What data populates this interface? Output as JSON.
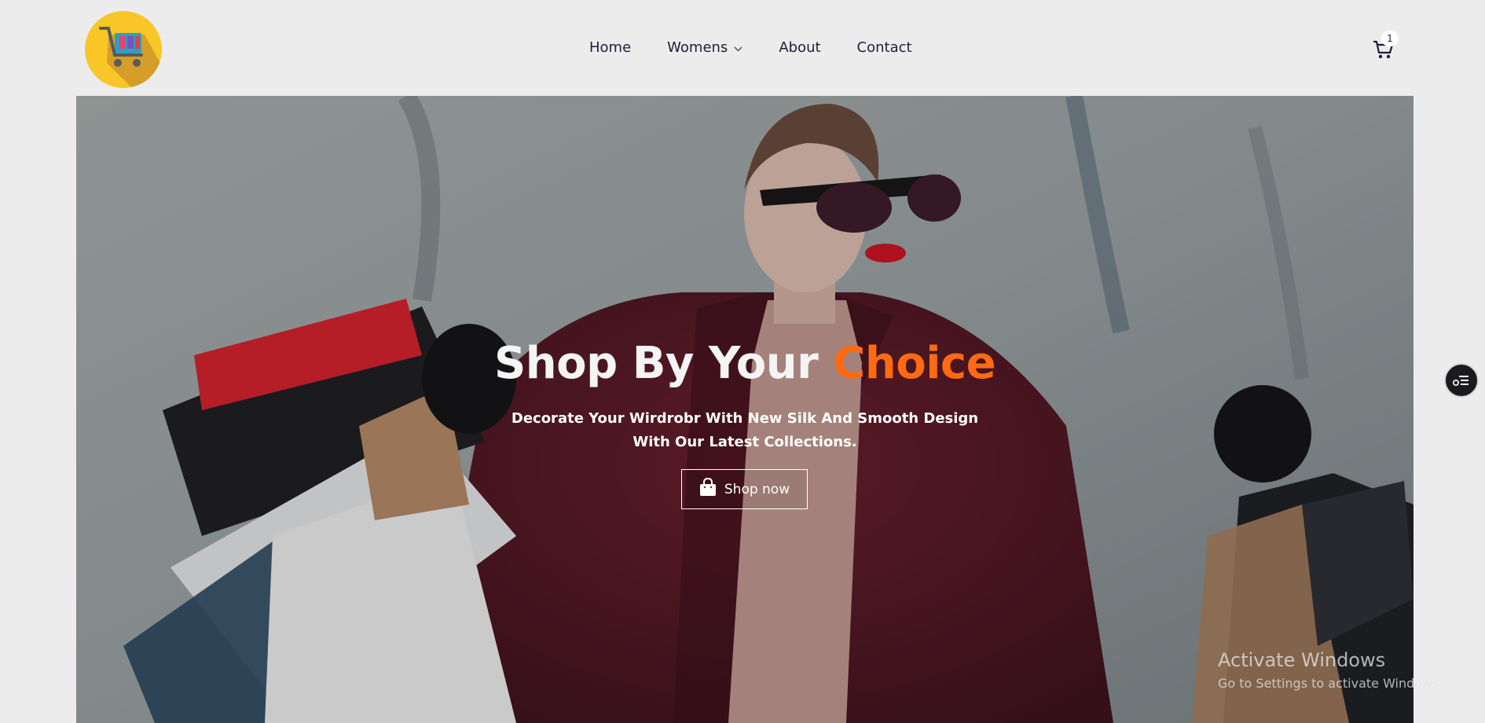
{
  "brand": {
    "logo_icon": "shopping-cart-logo",
    "logo_bg": "#f9c628"
  },
  "nav": {
    "items": [
      {
        "label": "Home"
      },
      {
        "label": "Womens",
        "has_dropdown": true
      },
      {
        "label": "About"
      },
      {
        "label": "Contact"
      }
    ]
  },
  "cart": {
    "icon": "cart-icon",
    "count": "1"
  },
  "hero": {
    "title_main": "Shop By Your ",
    "title_accent": "Choice",
    "accent_color": "#ff6a13",
    "subtitle": "Decorate Your Wirdrobr With New Silk And Smooth Design With Our Latest Collections.",
    "cta_label": "Shop now",
    "cta_icon": "shopping-bag-icon"
  },
  "watermark": {
    "title": "Activate Windows",
    "subtitle": "Go to Settings to activate Windows."
  },
  "floating_button": {
    "icon": "settings-list-icon"
  }
}
